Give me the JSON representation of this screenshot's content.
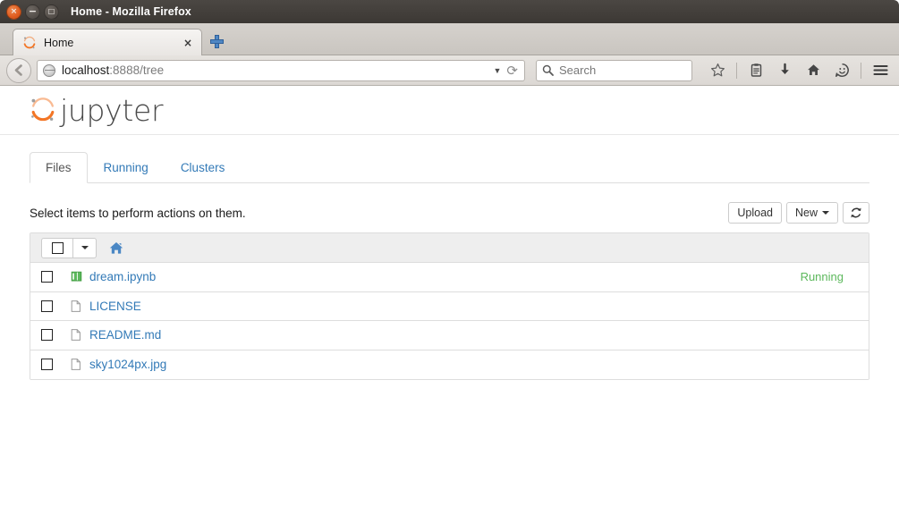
{
  "window": {
    "title": "Home - Mozilla Firefox",
    "controls": {
      "close": "×",
      "minimize": "−",
      "maximize": "□"
    }
  },
  "browser": {
    "tab": {
      "label": "Home",
      "favicon": "jupyter-favicon",
      "close_label": "×"
    },
    "new_tab_label": "+",
    "back_label": "←",
    "address": {
      "host": "localhost",
      "path": ":8888/tree",
      "full": "localhost:8888/tree",
      "dropdown_caret": "▼",
      "reload_label": "⟳"
    },
    "search": {
      "placeholder": "Search",
      "icon": "search-icon"
    },
    "toolbar_icons": [
      {
        "name": "bookmark-star-icon",
        "glyph": "☆"
      },
      {
        "name": "reading-list-icon",
        "glyph": "▤"
      },
      {
        "name": "downloads-icon",
        "glyph": "⬇"
      },
      {
        "name": "home-icon",
        "glyph": "⌂"
      },
      {
        "name": "sync-smiley-icon",
        "glyph": "☺"
      },
      {
        "name": "hamburger-menu-icon",
        "glyph": "☰"
      }
    ]
  },
  "jupyter": {
    "logo_text": "jupyter",
    "accent_color": "#f37626",
    "link_color": "#337ab7",
    "running_color": "#5cb85c",
    "tabs": [
      {
        "label": "Files",
        "active": true
      },
      {
        "label": "Running",
        "active": false
      },
      {
        "label": "Clusters",
        "active": false
      }
    ],
    "hint": "Select items to perform actions on them.",
    "actions": {
      "upload_label": "Upload",
      "new_label": "New",
      "refresh_label": "⟳"
    },
    "breadcrumb": {
      "home_icon": "home-icon"
    },
    "files": [
      {
        "name": "dream.ipynb",
        "icon": "notebook-icon",
        "status": "Running"
      },
      {
        "name": "LICENSE",
        "icon": "file-icon",
        "status": ""
      },
      {
        "name": "README.md",
        "icon": "file-icon",
        "status": ""
      },
      {
        "name": "sky1024px.jpg",
        "icon": "file-icon",
        "status": ""
      }
    ]
  }
}
